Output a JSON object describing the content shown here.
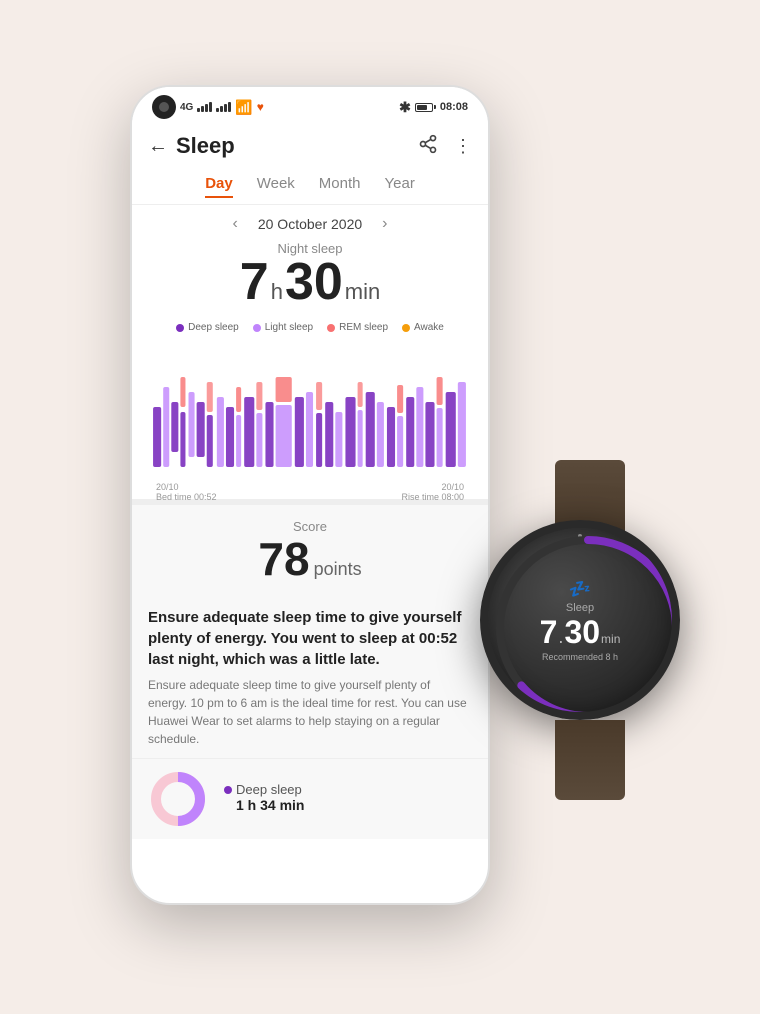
{
  "background_color": "#f5ede8",
  "status_bar": {
    "signal": "4G",
    "time": "08:08",
    "battery_icon": "battery"
  },
  "header": {
    "back_label": "←",
    "title": "Sleep",
    "share_icon": "share",
    "more_icon": "more"
  },
  "tabs": [
    {
      "label": "Day",
      "active": true
    },
    {
      "label": "Week",
      "active": false
    },
    {
      "label": "Month",
      "active": false
    },
    {
      "label": "Year",
      "active": false
    }
  ],
  "date_nav": {
    "prev_arrow": "‹",
    "date": "20 October 2020",
    "next_arrow": "›"
  },
  "sleep_summary": {
    "night_label": "Night sleep",
    "hours": "7",
    "hours_unit": "h",
    "minutes": "30",
    "minutes_unit": "min"
  },
  "legend": [
    {
      "label": "Deep sleep",
      "color": "#7b2fbe"
    },
    {
      "label": "Light sleep",
      "color": "#c084fc"
    },
    {
      "label": "REM sleep",
      "color": "#f87171"
    },
    {
      "label": "Awake",
      "color": "#f59e0b"
    }
  ],
  "chart": {
    "left_label_date": "20/10",
    "left_label_time": "Bed time 00:52",
    "right_label_date": "20/10",
    "right_label_time": "Rise time 08:00"
  },
  "score_section": {
    "label": "Score",
    "value": "78",
    "unit": "points"
  },
  "sleep_text_bold": "Ensure adequate sleep time to give yourself plenty of energy. You went to sleep at 00:52 last night, which was a little late.",
  "sleep_text_normal": "Ensure adequate sleep time to give yourself plenty of energy. 10 pm to 6 am is the ideal time for rest. You can use Huawei Wear to set alarms to help staying on a regular schedule.",
  "deep_sleep_stat": {
    "label": "Deep sleep",
    "value": "1 h 34 min",
    "color": "#7b2fbe"
  },
  "watch": {
    "sleep_icon": "💤",
    "sleep_label": "Sleep",
    "hours": "7",
    "dot": ".",
    "minutes": "30",
    "min_unit": "min",
    "recommended_label": "Recommended 8 h",
    "ring_color": "#7b2fbe",
    "ring_progress": 0.8
  }
}
